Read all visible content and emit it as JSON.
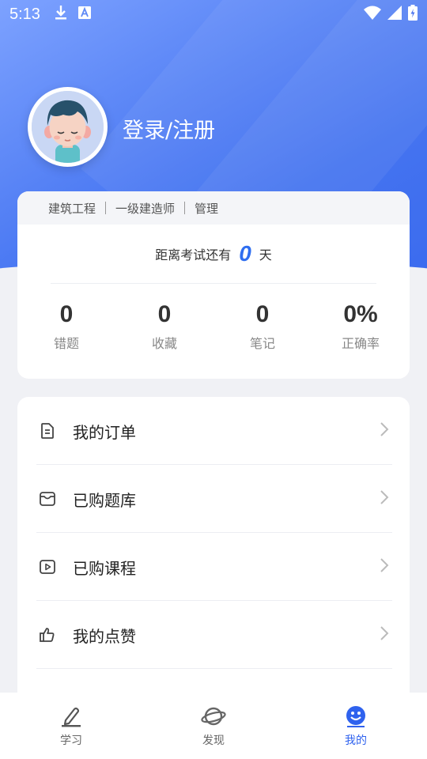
{
  "status_bar": {
    "time": "5:13",
    "icons_left": [
      "download-icon",
      "a-badge-icon"
    ],
    "icons_right": [
      "wifi-icon",
      "cell-signal-icon",
      "battery-charging-icon"
    ]
  },
  "profile": {
    "login_label": "登录/注册"
  },
  "exam_tags": [
    "建筑工程",
    "一级建造师",
    "管理"
  ],
  "countdown": {
    "prefix": "距离考试还有",
    "days": "0",
    "suffix": "天"
  },
  "stats": [
    {
      "value": "0",
      "label": "错题"
    },
    {
      "value": "0",
      "label": "收藏"
    },
    {
      "value": "0",
      "label": "笔记"
    },
    {
      "value": "0%",
      "label": "正确率"
    }
  ],
  "menu": [
    {
      "label": "我的订单",
      "icon": "document-icon"
    },
    {
      "label": "已购题库",
      "icon": "inbox-icon"
    },
    {
      "label": "已购课程",
      "icon": "play-icon"
    },
    {
      "label": "我的点赞",
      "icon": "thumbs-up-icon"
    }
  ],
  "tabs": [
    {
      "label": "学习",
      "icon": "pen-icon",
      "active": false
    },
    {
      "label": "发现",
      "icon": "planet-icon",
      "active": false
    },
    {
      "label": "我的",
      "icon": "smile-icon",
      "active": true
    }
  ],
  "colors": {
    "accent": "#2f62ee",
    "hero_start": "#7da2ff",
    "hero_end": "#2f62ee",
    "page_bg": "#f0f1f5"
  }
}
